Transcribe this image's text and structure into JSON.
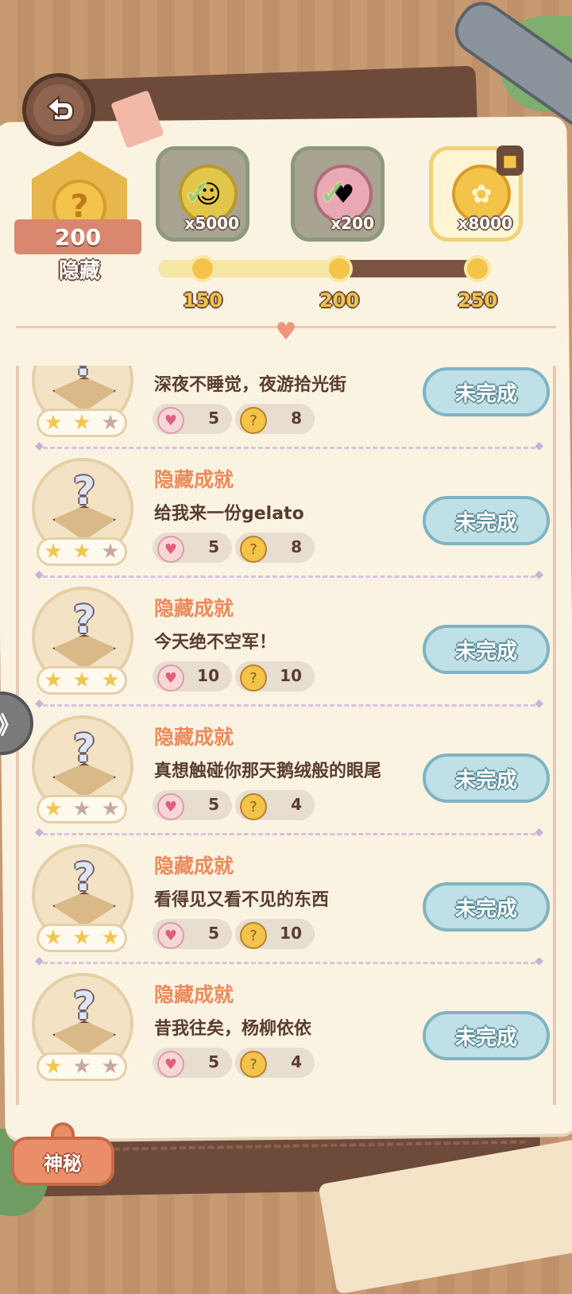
{
  "header": {
    "badge": {
      "points": "200",
      "label": "隐藏"
    },
    "rewards": [
      {
        "icon": "gold-coin-icon",
        "amount": "x5000",
        "state": "claimed"
      },
      {
        "icon": "heart-gem-icon",
        "amount": "x200",
        "state": "claimed"
      },
      {
        "icon": "bunny-coin-icon",
        "amount": "x8000",
        "state": "locked"
      }
    ],
    "progress": {
      "ticks": [
        "150",
        "200",
        "250"
      ],
      "current_points": 200
    }
  },
  "achievements": [
    {
      "tag": "",
      "title": "深夜不睡觉，夜游拾光街",
      "hearts": "5",
      "coins": "8",
      "stars": [
        1,
        1,
        0
      ],
      "status": "未完成"
    },
    {
      "tag": "隐藏成就",
      "title": "给我来一份gelato",
      "hearts": "5",
      "coins": "8",
      "stars": [
        1,
        1,
        0
      ],
      "status": "未完成"
    },
    {
      "tag": "隐藏成就",
      "title": "今天绝不空军！",
      "hearts": "10",
      "coins": "10",
      "stars": [
        1,
        1,
        1
      ],
      "status": "未完成"
    },
    {
      "tag": "隐藏成就",
      "title": "真想触碰你那天鹅绒般的眼尾",
      "hearts": "5",
      "coins": "4",
      "stars": [
        1,
        0,
        0
      ],
      "status": "未完成"
    },
    {
      "tag": "隐藏成就",
      "title": "看得见又看不见的东西",
      "hearts": "5",
      "coins": "10",
      "stars": [
        1,
        1,
        1
      ],
      "status": "未完成"
    },
    {
      "tag": "隐藏成就",
      "title": "昔我往矣，杨柳依依",
      "hearts": "5",
      "coins": "4",
      "stars": [
        1,
        0,
        0
      ],
      "status": "未完成"
    }
  ],
  "bottom_tab": {
    "label": "神秘"
  },
  "side_handle": {
    "glyph": "》"
  }
}
